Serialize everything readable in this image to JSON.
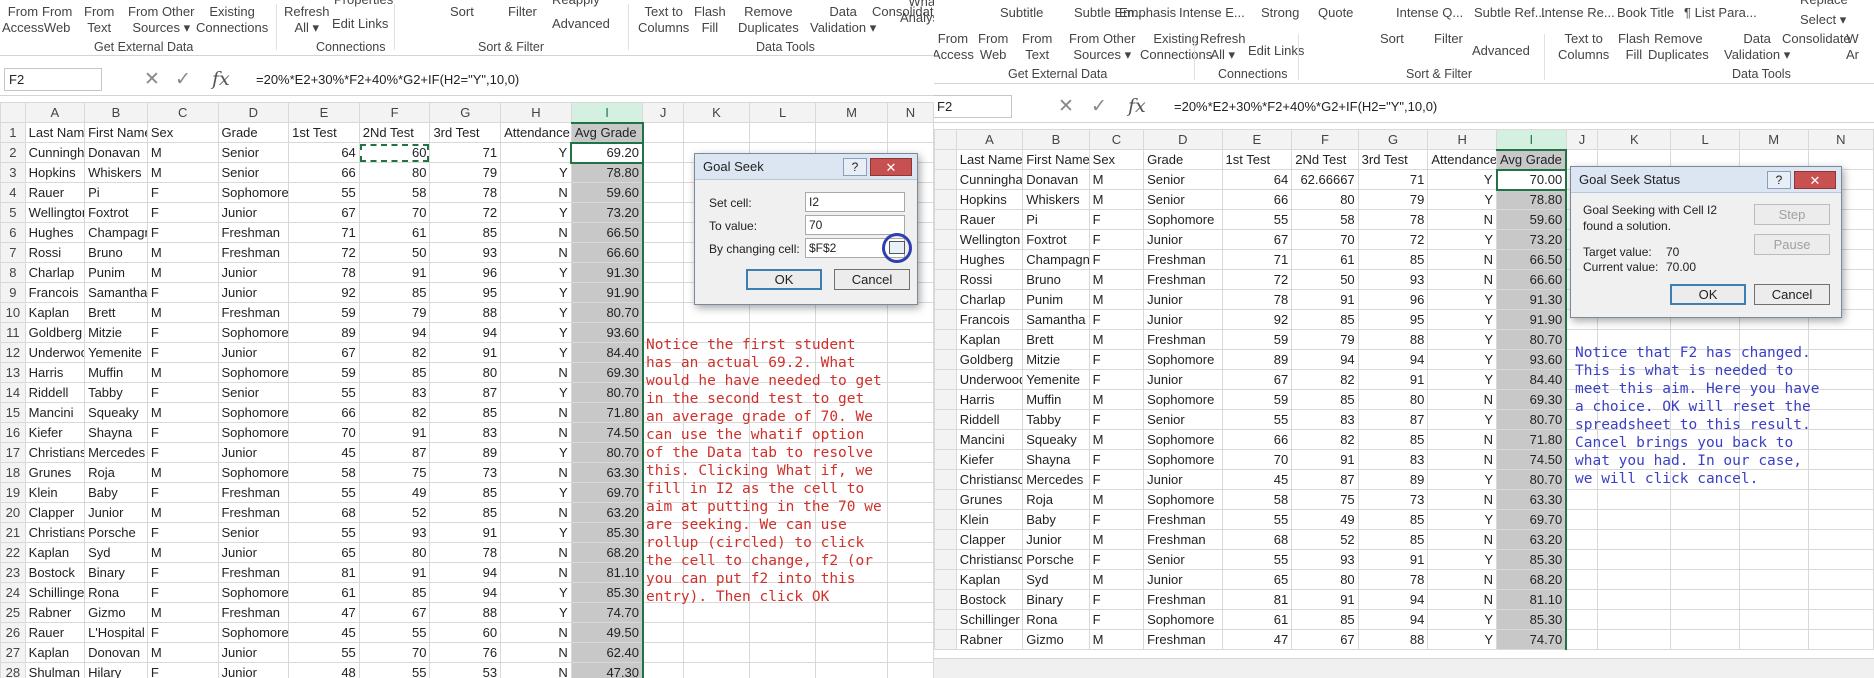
{
  "left": {
    "ribbon": {
      "buttons": [
        {
          "name": "from-access-button",
          "label": "From\nAccess"
        },
        {
          "name": "from-web-button",
          "label": "From\nWeb"
        },
        {
          "name": "from-text-button",
          "label": "From\nText"
        },
        {
          "name": "from-other-sources-button",
          "label": "From Other\nSources ▾"
        },
        {
          "name": "existing-connections-button",
          "label": "Existing\nConnections"
        },
        {
          "name": "refresh-all-button",
          "label": "Refresh\nAll ▾"
        },
        {
          "name": "properties-button",
          "label": "Properties"
        },
        {
          "name": "edit-links-button",
          "label": "Edit Links"
        },
        {
          "name": "sort-button",
          "label": "Sort"
        },
        {
          "name": "filter-button",
          "label": "Filter"
        },
        {
          "name": "reapply-button",
          "label": "Reapply"
        },
        {
          "name": "advanced-button",
          "label": "Advanced"
        },
        {
          "name": "text-to-columns-button",
          "label": "Text to\nColumns"
        },
        {
          "name": "flash-fill-button",
          "label": "Flash\nFill"
        },
        {
          "name": "remove-duplicates-button",
          "label": "Remove\nDuplicates"
        },
        {
          "name": "data-validation-button",
          "label": "Data\nValidation ▾"
        },
        {
          "name": "consolidate-button",
          "label": "Consolidate"
        },
        {
          "name": "what-if-analysis-button",
          "label": "What-If\nAnalysis ▾"
        },
        {
          "name": "relationships-button",
          "label": "Re"
        }
      ],
      "groups": [
        "Get External Data",
        "Connections",
        "Sort & Filter",
        "Data Tools"
      ]
    },
    "name_box": "F2",
    "formula": "=20%*E2+30%*F2+40%*G2+IF(H2=\"Y\",10,0)",
    "columns": [
      "A",
      "B",
      "C",
      "D",
      "E",
      "F",
      "G",
      "H",
      "I",
      "J",
      "K",
      "L",
      "M",
      "N"
    ],
    "header_row": [
      "Last Name",
      "First Name",
      "Sex",
      "Grade",
      "1st Test",
      "2Nd Test",
      "3rd Test",
      "Attendance",
      "Avg Grade"
    ],
    "rows": [
      [
        "2",
        "Cunningham",
        "Donavan",
        "M",
        "Senior",
        "64",
        "60",
        "71",
        "Y",
        "69.20"
      ],
      [
        "3",
        "Hopkins",
        "Whiskers",
        "M",
        "Senior",
        "66",
        "80",
        "79",
        "Y",
        "78.80"
      ],
      [
        "4",
        "Rauer",
        "Pi",
        "F",
        "Sophomore",
        "55",
        "58",
        "78",
        "N",
        "59.60"
      ],
      [
        "5",
        "Wellington",
        "Foxtrot",
        "F",
        "Junior",
        "67",
        "70",
        "72",
        "Y",
        "73.20"
      ],
      [
        "6",
        "Hughes",
        "Champagne",
        "F",
        "Freshman",
        "71",
        "61",
        "85",
        "N",
        "66.50"
      ],
      [
        "7",
        "Rossi",
        "Bruno",
        "M",
        "Freshman",
        "72",
        "50",
        "93",
        "N",
        "66.60"
      ],
      [
        "8",
        "Charlap",
        "Punim",
        "M",
        "Junior",
        "78",
        "91",
        "96",
        "Y",
        "91.30"
      ],
      [
        "9",
        "Francois",
        "Samantha",
        "F",
        "Junior",
        "92",
        "85",
        "95",
        "Y",
        "91.90"
      ],
      [
        "10",
        "Kaplan",
        "Brett",
        "M",
        "Freshman",
        "59",
        "79",
        "88",
        "Y",
        "80.70"
      ],
      [
        "11",
        "Goldberg",
        "Mitzie",
        "F",
        "Sophomore",
        "89",
        "94",
        "94",
        "Y",
        "93.60"
      ],
      [
        "12",
        "Underwood",
        "Yemenite",
        "F",
        "Junior",
        "67",
        "82",
        "91",
        "Y",
        "84.40"
      ],
      [
        "13",
        "Harris",
        "Muffin",
        "M",
        "Sophomore",
        "59",
        "85",
        "80",
        "N",
        "69.30"
      ],
      [
        "14",
        "Riddell",
        "Tabby",
        "F",
        "Senior",
        "55",
        "83",
        "87",
        "Y",
        "80.70"
      ],
      [
        "15",
        "Mancini",
        "Squeaky",
        "M",
        "Sophomore",
        "66",
        "82",
        "85",
        "N",
        "71.80"
      ],
      [
        "16",
        "Kiefer",
        "Shayna",
        "F",
        "Sophomore",
        "70",
        "91",
        "83",
        "N",
        "74.50"
      ],
      [
        "17",
        "Christianson",
        "Mercedes",
        "F",
        "Junior",
        "45",
        "87",
        "89",
        "Y",
        "80.70"
      ],
      [
        "18",
        "Grunes",
        "Roja",
        "M",
        "Sophomore",
        "58",
        "75",
        "73",
        "N",
        "63.30"
      ],
      [
        "19",
        "Klein",
        "Baby",
        "F",
        "Freshman",
        "55",
        "49",
        "85",
        "Y",
        "69.70"
      ],
      [
        "20",
        "Clapper",
        "Junior",
        "M",
        "Freshman",
        "68",
        "52",
        "85",
        "N",
        "63.20"
      ],
      [
        "21",
        "Christianson",
        "Porsche",
        "F",
        "Senior",
        "55",
        "93",
        "91",
        "Y",
        "85.30"
      ],
      [
        "22",
        "Kaplan",
        "Syd",
        "M",
        "Junior",
        "65",
        "80",
        "78",
        "N",
        "68.20"
      ],
      [
        "23",
        "Bostock",
        "Binary",
        "F",
        "Freshman",
        "81",
        "91",
        "94",
        "N",
        "81.10"
      ],
      [
        "24",
        "Schillinger",
        "Rona",
        "F",
        "Sophomore",
        "61",
        "85",
        "94",
        "Y",
        "85.30"
      ],
      [
        "25",
        "Rabner",
        "Gizmo",
        "M",
        "Freshman",
        "47",
        "67",
        "88",
        "Y",
        "74.70"
      ],
      [
        "26",
        "Rauer",
        "L'Hospital",
        "F",
        "Sophomore",
        "45",
        "55",
        "60",
        "N",
        "49.50"
      ],
      [
        "27",
        "Kaplan",
        "Donovan",
        "M",
        "Junior",
        "55",
        "70",
        "76",
        "N",
        "62.40"
      ],
      [
        "28",
        "Shulman",
        "Hilary",
        "F",
        "Junior",
        "48",
        "55",
        "53",
        "N",
        "47.30"
      ]
    ],
    "dialog": {
      "title": "Goal Seek",
      "help": "?",
      "close": "✕",
      "set_cell_label": "Set cell:",
      "set_cell_value": "I2",
      "to_value_label": "To value:",
      "to_value_value": "70",
      "changing_label": "By changing cell:",
      "changing_value": "$F$2",
      "ok": "OK",
      "cancel": "Cancel"
    },
    "note": "Notice the first student\nhas an actual 69.2. What\nwould he have needed to get\nin the second test to get\nan average grade of 70. We\ncan use the whatif option\nof the Data tab to resolve\nthis. Clicking What if, we\nfill in I2 as the cell to\naim at putting in the 70 we\nare seeking. We can use\nrollup (circled) to click\nthe cell to change, f2 (or\nyou can put f2 into this\nentry). Then click OK",
    "note_color": "#d0302a"
  },
  "right": {
    "styles": [
      "Subtitle",
      "Subtle Em...",
      "Emphasis",
      "Intense E...",
      "Strong",
      "Quote",
      "Intense Q...",
      "Subtle Ref...",
      "Intense Re...",
      "Book Title",
      "¶ List Para..."
    ],
    "replace_label": "Replace",
    "select_label": "Select ▾",
    "ribbon": {
      "buttons": [
        {
          "name": "from-access-button",
          "label": "From\nAccess"
        },
        {
          "name": "from-web-button",
          "label": "From\nWeb"
        },
        {
          "name": "from-text-button",
          "label": "From\nText"
        },
        {
          "name": "from-other-sources-button",
          "label": "From Other\nSources ▾"
        },
        {
          "name": "existing-connections-button",
          "label": "Existing\nConnections"
        },
        {
          "name": "refresh-all-button",
          "label": "Refresh\nAll ▾"
        },
        {
          "name": "edit-links-button",
          "label": "Edit Links"
        },
        {
          "name": "sort-button",
          "label": "Sort"
        },
        {
          "name": "filter-button",
          "label": "Filter"
        },
        {
          "name": "advanced-button",
          "label": "Advanced"
        },
        {
          "name": "text-to-columns-button",
          "label": "Text to\nColumns"
        },
        {
          "name": "flash-fill-button",
          "label": "Flash\nFill"
        },
        {
          "name": "remove-duplicates-button",
          "label": "Remove\nDuplicates"
        },
        {
          "name": "data-validation-button",
          "label": "Data\nValidation ▾"
        },
        {
          "name": "consolidate-button",
          "label": "Consolidate"
        },
        {
          "name": "what-if-button",
          "label": "W\nAr"
        }
      ],
      "groups": [
        "Get External Data",
        "Connections",
        "Sort & Filter",
        "Data Tools"
      ]
    },
    "name_box": "F2",
    "formula": "=20%*E2+30%*F2+40%*G2+IF(H2=\"Y\",10,0)",
    "columns": [
      "A",
      "B",
      "C",
      "D",
      "E",
      "F",
      "G",
      "H",
      "I",
      "J",
      "K",
      "L",
      "M",
      "N"
    ],
    "header_row": [
      "Last Name",
      "First Name",
      "Sex",
      "Grade",
      "1st Test",
      "2Nd Test",
      "3rd Test",
      "Attendance",
      "Avg Grade"
    ],
    "rows": [
      [
        "",
        "Cunningham",
        "Donavan",
        "M",
        "Senior",
        "64",
        "62.66667",
        "71",
        "Y",
        "70.00"
      ],
      [
        "",
        "Hopkins",
        "Whiskers",
        "M",
        "Senior",
        "66",
        "80",
        "79",
        "Y",
        "78.80"
      ],
      [
        "",
        "Rauer",
        "Pi",
        "F",
        "Sophomore",
        "55",
        "58",
        "78",
        "N",
        "59.60"
      ],
      [
        "",
        "Wellington",
        "Foxtrot",
        "F",
        "Junior",
        "67",
        "70",
        "72",
        "Y",
        "73.20"
      ],
      [
        "",
        "Hughes",
        "Champagne",
        "F",
        "Freshman",
        "71",
        "61",
        "85",
        "N",
        "66.50"
      ],
      [
        "",
        "Rossi",
        "Bruno",
        "M",
        "Freshman",
        "72",
        "50",
        "93",
        "N",
        "66.60"
      ],
      [
        "",
        "Charlap",
        "Punim",
        "M",
        "Junior",
        "78",
        "91",
        "96",
        "Y",
        "91.30"
      ],
      [
        "",
        "Francois",
        "Samantha",
        "F",
        "Junior",
        "92",
        "85",
        "95",
        "Y",
        "91.90"
      ],
      [
        "",
        "Kaplan",
        "Brett",
        "M",
        "Freshman",
        "59",
        "79",
        "88",
        "Y",
        "80.70"
      ],
      [
        "",
        "Goldberg",
        "Mitzie",
        "F",
        "Sophomore",
        "89",
        "94",
        "94",
        "Y",
        "93.60"
      ],
      [
        "",
        "Underwood",
        "Yemenite",
        "F",
        "Junior",
        "67",
        "82",
        "91",
        "Y",
        "84.40"
      ],
      [
        "",
        "Harris",
        "Muffin",
        "M",
        "Sophomore",
        "59",
        "85",
        "80",
        "N",
        "69.30"
      ],
      [
        "",
        "Riddell",
        "Tabby",
        "F",
        "Senior",
        "55",
        "83",
        "87",
        "Y",
        "80.70"
      ],
      [
        "",
        "Mancini",
        "Squeaky",
        "M",
        "Sophomore",
        "66",
        "82",
        "85",
        "N",
        "71.80"
      ],
      [
        "",
        "Kiefer",
        "Shayna",
        "F",
        "Sophomore",
        "70",
        "91",
        "83",
        "N",
        "74.50"
      ],
      [
        "",
        "Christianson",
        "Mercedes",
        "F",
        "Junior",
        "45",
        "87",
        "89",
        "Y",
        "80.70"
      ],
      [
        "",
        "Grunes",
        "Roja",
        "M",
        "Sophomore",
        "58",
        "75",
        "73",
        "N",
        "63.30"
      ],
      [
        "",
        "Klein",
        "Baby",
        "F",
        "Freshman",
        "55",
        "49",
        "85",
        "Y",
        "69.70"
      ],
      [
        "",
        "Clapper",
        "Junior",
        "M",
        "Freshman",
        "68",
        "52",
        "85",
        "N",
        "63.20"
      ],
      [
        "",
        "Christianson",
        "Porsche",
        "F",
        "Senior",
        "55",
        "93",
        "91",
        "Y",
        "85.30"
      ],
      [
        "",
        "Kaplan",
        "Syd",
        "M",
        "Junior",
        "65",
        "80",
        "78",
        "N",
        "68.20"
      ],
      [
        "",
        "Bostock",
        "Binary",
        "F",
        "Freshman",
        "81",
        "91",
        "94",
        "N",
        "81.10"
      ],
      [
        "",
        "Schillinger",
        "Rona",
        "F",
        "Sophomore",
        "61",
        "85",
        "94",
        "Y",
        "85.30"
      ],
      [
        "",
        "Rabner",
        "Gizmo",
        "M",
        "Freshman",
        "47",
        "67",
        "88",
        "Y",
        "74.70"
      ]
    ],
    "dialog": {
      "title": "Goal Seek Status",
      "help": "?",
      "close": "✕",
      "line1": "Goal Seeking with Cell I2",
      "line2": "found a solution.",
      "target_label": "Target value:",
      "target_value": "70",
      "current_label": "Current value:",
      "current_value": "70.00",
      "step": "Step",
      "pause": "Pause",
      "ok": "OK",
      "cancel": "Cancel"
    },
    "note": "Notice that F2 has changed.\nThis is what is needed to\nmeet this aim. Here you have\na choice. OK will reset the\nspreadsheet to this result.\nCancel brings you back to\nwhat you had. In our case,\nwe will click cancel.",
    "note_color": "#3b3fc4"
  }
}
